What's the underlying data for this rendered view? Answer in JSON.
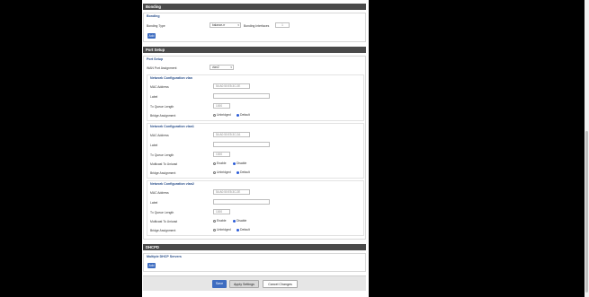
{
  "bonding": {
    "title": "Bonding",
    "subtitle": "Bonding",
    "type_label": "Bonding Type",
    "type_value": "balance-rr",
    "iface_label": "Bonding Interfaces",
    "iface_value": "1",
    "add_label": "Add"
  },
  "port_setup": {
    "title": "Port Setup",
    "subtitle": "Port Setup",
    "wan_label": "WAN Port Assignment",
    "wan_value": "vlan2",
    "groups": [
      {
        "heading": "Network Configuration vlan",
        "mac_label": "MAC Address",
        "mac_value": "54:A0:50:E5:3C:2E",
        "label_label": "Label",
        "label_value": "",
        "txq_label": "Tx Queue Length",
        "txq_value": "1000",
        "bridge_label": "Bridge Assignment",
        "bridge_opt1": "Unbridged",
        "bridge_opt2": "Default"
      },
      {
        "heading": "Network Configuration vlan1",
        "mac_label": "MAC Address",
        "mac_value": "54:A0:50:E5:3C:2A",
        "label_label": "Label",
        "label_value": "",
        "txq_label": "Tx Queue Length",
        "txq_value": "1000",
        "multicast_label": "Multicast To Unicast",
        "multicast_opt1": "Enable",
        "multicast_opt2": "Disable",
        "bridge_label": "Bridge Assignment",
        "bridge_opt1": "Unbridged",
        "bridge_opt2": "Default"
      },
      {
        "heading": "Network Configuration vlan2",
        "mac_label": "MAC Address",
        "mac_value": "54:A0:50:E5:3C:2E",
        "label_label": "Label",
        "label_value": "",
        "txq_label": "Tx Queue Length",
        "txq_value": "1000",
        "multicast_label": "Multicast To Unicast",
        "multicast_opt1": "Enable",
        "multicast_opt2": "Disable",
        "bridge_label": "Bridge Assignment",
        "bridge_opt1": "Unbridged",
        "bridge_opt2": "Default"
      }
    ]
  },
  "dhcpd": {
    "title": "DHCPD",
    "subtitle": "Multiple DHCP Servers",
    "add_label": "Add"
  },
  "footer": {
    "save": "Save",
    "apply": "Apply Settings",
    "cancel": "Cancel Changes"
  },
  "colors": {
    "section_bar": "#4a4a4a",
    "primary_button": "#3d6cc0",
    "subtitle": "#2a4f8a"
  }
}
